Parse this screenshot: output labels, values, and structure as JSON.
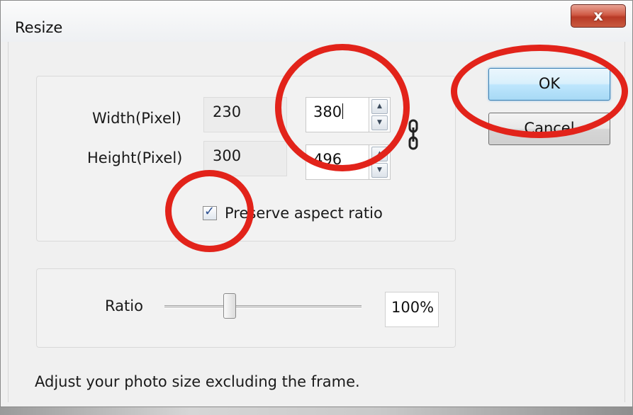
{
  "dialog": {
    "title": "Resize",
    "close_glyph": "x"
  },
  "size_group": {
    "width_label": "Width(Pixel)",
    "height_label": "Height(Pixel)",
    "original_width": "230",
    "original_height": "300",
    "new_width": "380",
    "new_height": "496",
    "preserve_label": "Preserve aspect ratio",
    "preserve_checked": true
  },
  "ratio_group": {
    "label": "Ratio",
    "value_text": "100%",
    "slider_position_fraction": 0.33
  },
  "buttons": {
    "ok": "OK",
    "cancel": "Cancel"
  },
  "footer": {
    "hint": "Adjust your photo size excluding the frame."
  },
  "icons": {
    "close": "close-icon",
    "link": "chain-link-icon",
    "check": "checkmark-icon",
    "spin_up": "chevron-up-icon",
    "spin_down": "chevron-down-icon"
  },
  "colors": {
    "annotation": "#e2231a",
    "ok_focus": "#3c7fb1",
    "close_button": "#c8472f"
  }
}
